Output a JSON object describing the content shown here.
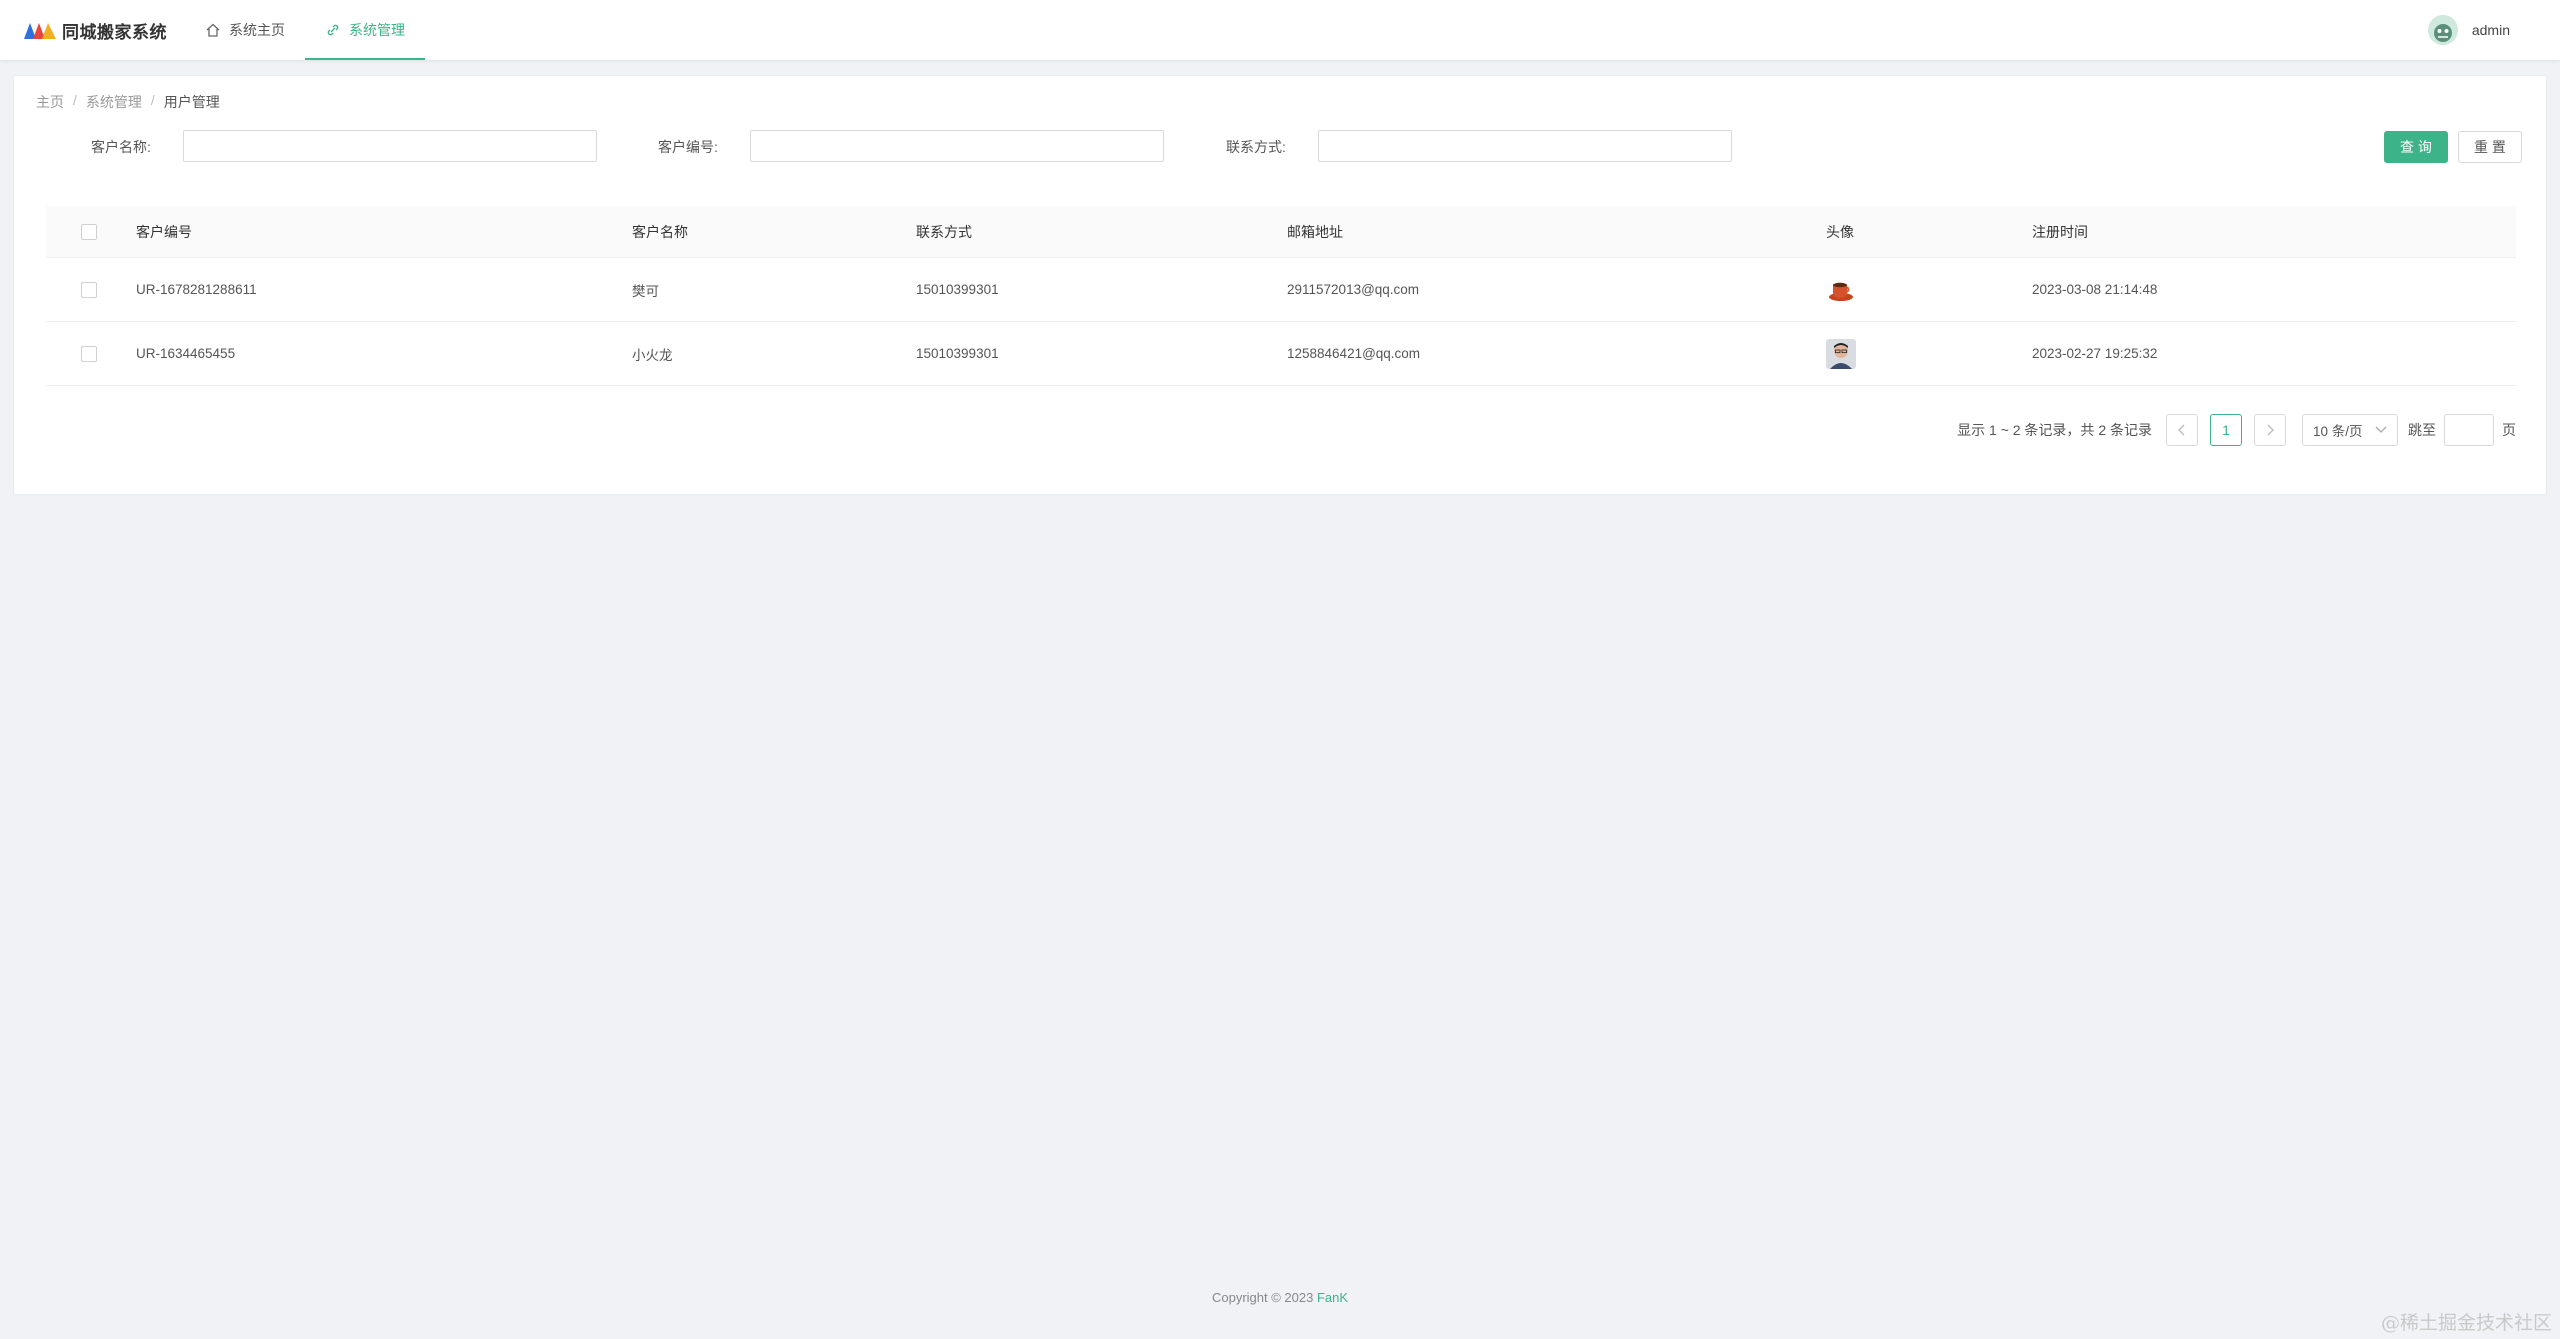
{
  "header": {
    "app_title": "同城搬家系统",
    "nav": [
      {
        "label": "系统主页",
        "icon": "home-icon",
        "active": false
      },
      {
        "label": "系统管理",
        "icon": "link-icon",
        "active": true
      }
    ],
    "user": {
      "name": "admin"
    }
  },
  "breadcrumb": [
    "主页",
    "系统管理",
    "用户管理"
  ],
  "breadcrumb_sep": "/",
  "search": {
    "name_label": "客户名称:",
    "code_label": "客户编号:",
    "phone_label": "联系方式:",
    "name_value": "",
    "code_value": "",
    "phone_value": "",
    "query_button": "查 询",
    "reset_button": "重 置"
  },
  "table": {
    "columns": [
      "客户编号",
      "客户名称",
      "联系方式",
      "邮箱地址",
      "头像",
      "注册时间"
    ],
    "rows": [
      {
        "code": "UR-1678281288611",
        "name": "樊可",
        "phone": "15010399301",
        "email": "2911572013@qq.com",
        "avatar": "coffee-cup-avatar",
        "time": "2023-03-08 21:14:48"
      },
      {
        "code": "UR-1634465455",
        "name": "小火龙",
        "phone": "15010399301",
        "email": "1258846421@qq.com",
        "avatar": "portrait-avatar",
        "time": "2023-02-27 19:25:32"
      }
    ]
  },
  "pagination": {
    "total_text": "显示 1 ~ 2 条记录，共 2 条记录",
    "current_page": "1",
    "page_size": "10 条/页",
    "jump_label": "跳至",
    "page_suffix": "页"
  },
  "footer": {
    "copyright": "Copyright © 2023",
    "author": "FanK"
  },
  "watermark": "@稀土掘金技术社区",
  "colors": {
    "accent": "#3db389",
    "background": "#f0f2f5"
  }
}
